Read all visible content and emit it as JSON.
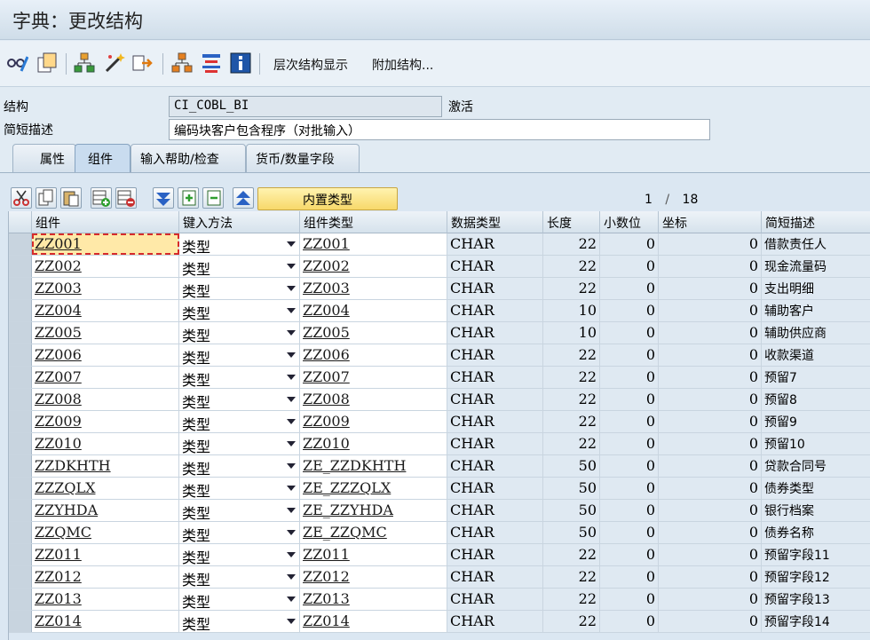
{
  "window": {
    "title": "字典：更改结构"
  },
  "toolbar": {
    "icons": [
      "glasses-pencil-icon",
      "copy-icon",
      "hierarchy-icon",
      "magic-wand-icon",
      "forward-icon",
      "org-structure-icon",
      "list-format-icon",
      "info-icon"
    ],
    "hierarchy_display": "层次结构显示",
    "append_structure": "附加结构..."
  },
  "header": {
    "structure_label": "结构",
    "structure_value": "CI_COBL_BI",
    "status": "激活",
    "short_desc_label": "简短描述",
    "short_desc_value": "编码块客户包含程序（对批输入）"
  },
  "tabs": [
    {
      "label": "属性"
    },
    {
      "label": "组件"
    },
    {
      "label": "输入帮助/检查"
    },
    {
      "label": "货币/数量字段"
    }
  ],
  "grid_toolbar": {
    "icons": [
      "cut-icon",
      "copy-icon",
      "paste-icon",
      "insert-row-icon",
      "delete-row-icon",
      "expand-icon",
      "insert-icon",
      "collapse-icon",
      "top-icon"
    ],
    "builtin_type_label": "内置类型",
    "page_current": "1",
    "page_sep": "/",
    "page_total": "18"
  },
  "columns": {
    "component": "组件",
    "entry_method": "键入方法",
    "component_type": "组件类型",
    "data_type": "数据类型",
    "length": "长度",
    "decimals": "小数位",
    "coordinate": "坐标",
    "short_desc": "简短描述"
  },
  "rows": [
    {
      "component": "ZZ001",
      "entry": "类型",
      "type": "ZZ001",
      "dtype": "CHAR",
      "len": "22",
      "dec": "0",
      "coord": "0",
      "desc": "借款责任人"
    },
    {
      "component": "ZZ002",
      "entry": "类型",
      "type": "ZZ002",
      "dtype": "CHAR",
      "len": "22",
      "dec": "0",
      "coord": "0",
      "desc": "现金流量码"
    },
    {
      "component": "ZZ003",
      "entry": "类型",
      "type": "ZZ003",
      "dtype": "CHAR",
      "len": "22",
      "dec": "0",
      "coord": "0",
      "desc": "支出明细"
    },
    {
      "component": "ZZ004",
      "entry": "类型",
      "type": "ZZ004",
      "dtype": "CHAR",
      "len": "10",
      "dec": "0",
      "coord": "0",
      "desc": "辅助客户"
    },
    {
      "component": "ZZ005",
      "entry": "类型",
      "type": "ZZ005",
      "dtype": "CHAR",
      "len": "10",
      "dec": "0",
      "coord": "0",
      "desc": "辅助供应商"
    },
    {
      "component": "ZZ006",
      "entry": "类型",
      "type": "ZZ006",
      "dtype": "CHAR",
      "len": "22",
      "dec": "0",
      "coord": "0",
      "desc": "收款渠道"
    },
    {
      "component": "ZZ007",
      "entry": "类型",
      "type": "ZZ007",
      "dtype": "CHAR",
      "len": "22",
      "dec": "0",
      "coord": "0",
      "desc": "预留7"
    },
    {
      "component": "ZZ008",
      "entry": "类型",
      "type": "ZZ008",
      "dtype": "CHAR",
      "len": "22",
      "dec": "0",
      "coord": "0",
      "desc": "预留8"
    },
    {
      "component": "ZZ009",
      "entry": "类型",
      "type": "ZZ009",
      "dtype": "CHAR",
      "len": "22",
      "dec": "0",
      "coord": "0",
      "desc": "预留9"
    },
    {
      "component": "ZZ010",
      "entry": "类型",
      "type": "ZZ010",
      "dtype": "CHAR",
      "len": "22",
      "dec": "0",
      "coord": "0",
      "desc": "预留10"
    },
    {
      "component": "ZZDKHTH",
      "entry": "类型",
      "type": "ZE_ZZDKHTH",
      "dtype": "CHAR",
      "len": "50",
      "dec": "0",
      "coord": "0",
      "desc": "贷款合同号"
    },
    {
      "component": "ZZZQLX",
      "entry": "类型",
      "type": "ZE_ZZZQLX",
      "dtype": "CHAR",
      "len": "50",
      "dec": "0",
      "coord": "0",
      "desc": "债券类型"
    },
    {
      "component": "ZZYHDA",
      "entry": "类型",
      "type": "ZE_ZZYHDA",
      "dtype": "CHAR",
      "len": "50",
      "dec": "0",
      "coord": "0",
      "desc": "银行档案"
    },
    {
      "component": "ZZQMC",
      "entry": "类型",
      "type": "ZE_ZZQMC",
      "dtype": "CHAR",
      "len": "50",
      "dec": "0",
      "coord": "0",
      "desc": "债券名称"
    },
    {
      "component": "ZZ011",
      "entry": "类型",
      "type": "ZZ011",
      "dtype": "CHAR",
      "len": "22",
      "dec": "0",
      "coord": "0",
      "desc": "预留字段11"
    },
    {
      "component": "ZZ012",
      "entry": "类型",
      "type": "ZZ012",
      "dtype": "CHAR",
      "len": "22",
      "dec": "0",
      "coord": "0",
      "desc": "预留字段12"
    },
    {
      "component": "ZZ013",
      "entry": "类型",
      "type": "ZZ013",
      "dtype": "CHAR",
      "len": "22",
      "dec": "0",
      "coord": "0",
      "desc": "预留字段13"
    },
    {
      "component": "ZZ014",
      "entry": "类型",
      "type": "ZZ014",
      "dtype": "CHAR",
      "len": "22",
      "dec": "0",
      "coord": "0",
      "desc": "预留字段14"
    }
  ],
  "colors": {
    "focus_outline": "#d62b2b",
    "button_yellow": "#f7d86a",
    "panel_bg": "#dbe7f2"
  }
}
